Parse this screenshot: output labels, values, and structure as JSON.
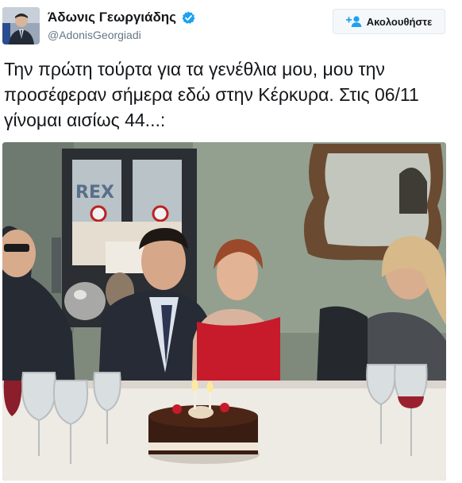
{
  "user": {
    "name": "Άδωνις Γεωργιάδης",
    "handle": "@AdonisGeorgiadi",
    "verified": true,
    "verified_icon": "verified-badge-icon"
  },
  "follow_button": {
    "label": "Ακολουθήστε",
    "icon": "add-user-icon",
    "color": "#1da1f2"
  },
  "tweet": {
    "text": "Την πρώτη τούρτα για τα γενέθλια μου, μου την προσέφεραν σήμερα εδώ στην Κέρκυρα. Στις 06/11 γίνομαι αισίως 44...:"
  },
  "photo": {
    "sign_text": "REX"
  },
  "colors": {
    "text": "#14171a",
    "secondary": "#657786",
    "verified": "#1da1f2",
    "border": "#e1e8ed"
  }
}
